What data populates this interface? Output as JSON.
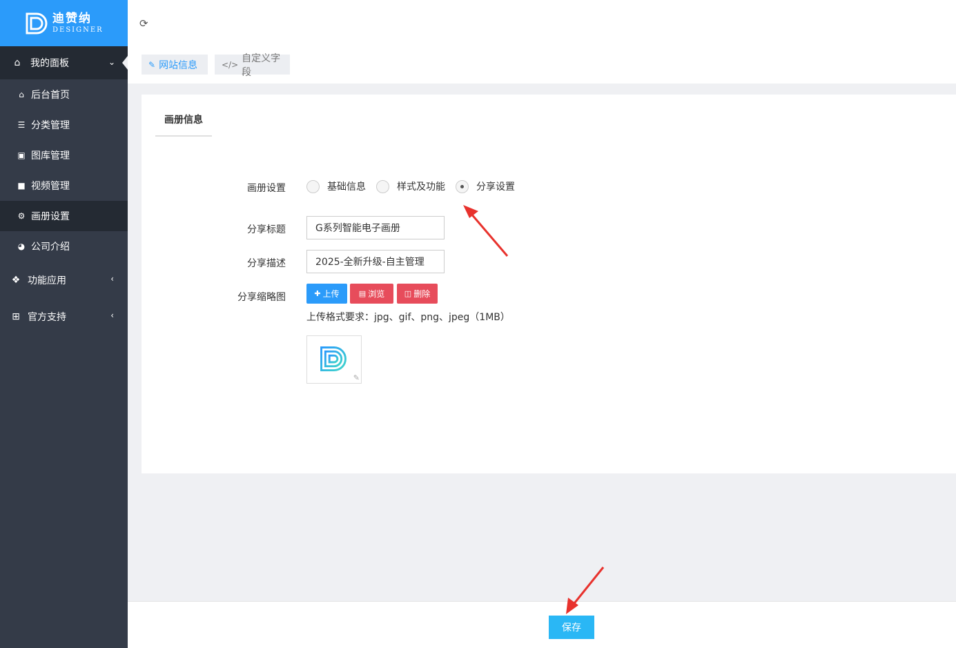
{
  "brand": {
    "name_cn": "迪赞纳",
    "name_en": "DESIGNER",
    "color": "#2b9bfa"
  },
  "sidebar": {
    "group_dashboard": {
      "label": "我的面板",
      "icon": "home-icon"
    },
    "items": [
      {
        "label": "后台首页",
        "icon": "home-icon"
      },
      {
        "label": "分类管理",
        "icon": "list-icon"
      },
      {
        "label": "图库管理",
        "icon": "image-icon"
      },
      {
        "label": "视频管理",
        "icon": "video-icon"
      },
      {
        "label": "画册设置",
        "icon": "gear-icon",
        "active": true
      },
      {
        "label": "公司介绍",
        "icon": "compass-icon"
      }
    ],
    "group_apps": {
      "label": "功能应用",
      "icon": "puzzle-icon"
    },
    "group_support": {
      "label": "官方支持",
      "icon": "medkit-icon"
    }
  },
  "tabs": [
    {
      "label": "网站信息",
      "icon": "edit-icon",
      "active": true
    },
    {
      "label": "自定义字段",
      "icon": "code-icon"
    }
  ],
  "card": {
    "tab_title": "画册信息",
    "album_setting_label": "画册设置",
    "radios": [
      {
        "label": "基础信息",
        "checked": false
      },
      {
        "label": "样式及功能",
        "checked": false
      },
      {
        "label": "分享设置",
        "checked": true
      }
    ],
    "share_title_label": "分享标题",
    "share_title_value": "G系列智能电子画册",
    "share_desc_label": "分享描述",
    "share_desc_value": "2025-全新升级-自主管理",
    "thumb_label": "分享缩略图",
    "upload_label": "上传",
    "browse_label": "浏览",
    "delete_label": "删除",
    "format_hint": "上传格式要求：jpg、gif、png、jpeg（1MB）"
  },
  "footer": {
    "save_label": "保存"
  },
  "colors": {
    "primary": "#2b9bfa",
    "danger": "#e74c5b",
    "save": "#2ab7f5",
    "annotation_arrow": "#e8322d"
  }
}
